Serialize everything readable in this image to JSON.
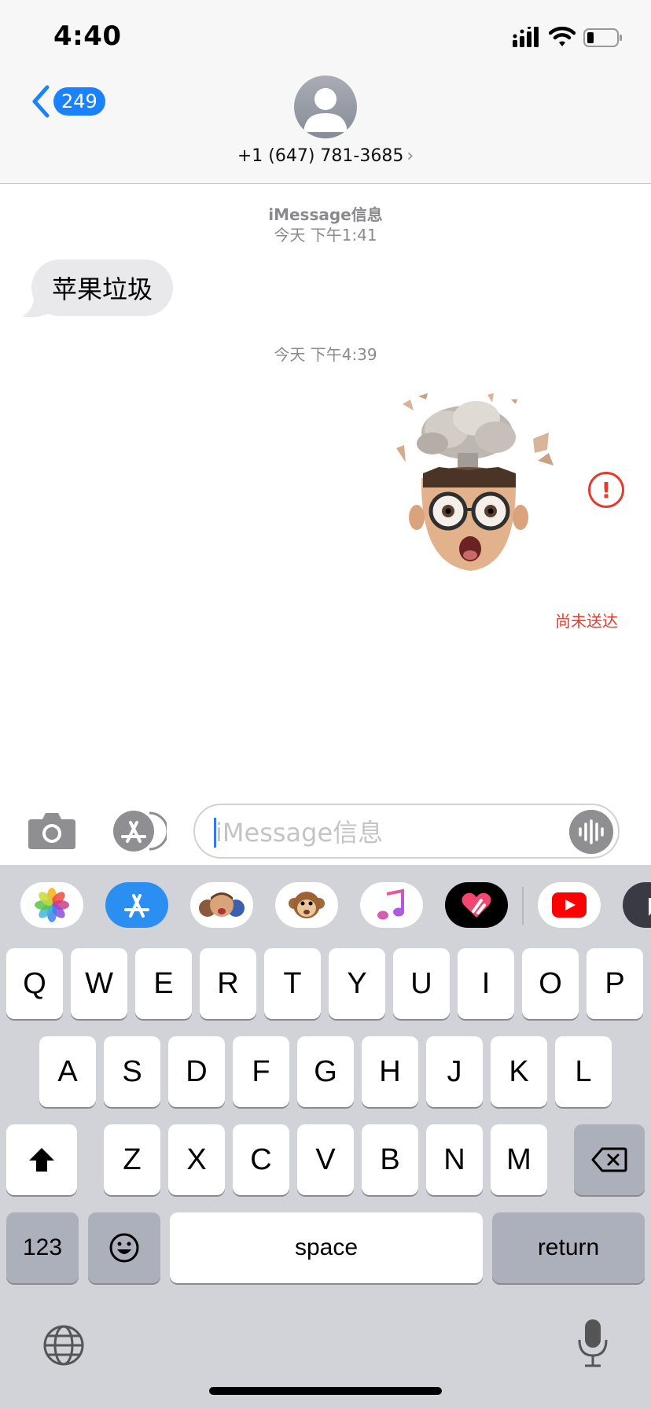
{
  "status_bar": {
    "time": "4:40"
  },
  "header": {
    "back_count": "249",
    "contact": "+1 (647) 781-3685",
    "contact_chevron": "›"
  },
  "conversation": {
    "timestamp1_service": "iMessage信息",
    "timestamp1_time": "今天 下午1:41",
    "incoming_message": "苹果垃圾",
    "timestamp2_time": "今天 下午4:39",
    "outgoing_sticker": "memoji-mind-blown",
    "error_glyph": "!",
    "not_delivered": "尚未送达"
  },
  "input_bar": {
    "placeholder": "iMessage信息"
  },
  "app_strip": [
    {
      "name": "photos-app-icon"
    },
    {
      "name": "appstore-app-icon"
    },
    {
      "name": "memoji-app-icon"
    },
    {
      "name": "animoji-app-icon"
    },
    {
      "name": "music-app-icon"
    },
    {
      "name": "digital-touch-app-icon"
    },
    {
      "name": "youtube-app-icon"
    },
    {
      "name": "more-apps-icon"
    }
  ],
  "keyboard": {
    "row1": [
      "Q",
      "W",
      "E",
      "R",
      "T",
      "Y",
      "U",
      "I",
      "O",
      "P"
    ],
    "row2": [
      "A",
      "S",
      "D",
      "F",
      "G",
      "H",
      "J",
      "K",
      "L"
    ],
    "row3": [
      "Z",
      "X",
      "C",
      "V",
      "B",
      "N",
      "M"
    ],
    "numbers": "123",
    "space": "space",
    "return": "return"
  },
  "colors": {
    "accent": "#1a82fb",
    "error": "#e33b2e",
    "keyboard_bg": "#d1d3d9"
  }
}
